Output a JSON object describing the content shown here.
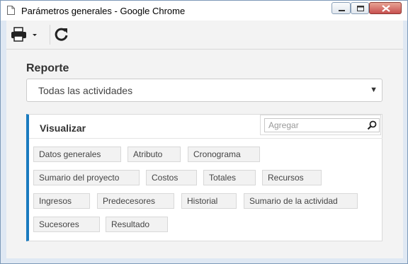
{
  "window": {
    "title": "Parámetros generales - Google Chrome",
    "close_color": "#c75050"
  },
  "toolbar": {
    "print_icon": "printer-icon",
    "dropdown_icon": "caret-down-icon",
    "refresh_icon": "refresh-icon"
  },
  "report": {
    "label": "Reporte",
    "selected": "Todas las actividades"
  },
  "visualizar": {
    "title": "Visualizar",
    "search_placeholder": "Agregar",
    "accent_color": "#1a7bbf",
    "tags": [
      "Datos generales",
      "Atributo",
      "Cronograma",
      "Sumario del proyecto",
      "Costos",
      "Totales",
      "Recursos",
      "Ingresos",
      "Predecesores",
      "Historial",
      "Sumario de la actividad",
      "Sucesores",
      "Resultado"
    ]
  }
}
